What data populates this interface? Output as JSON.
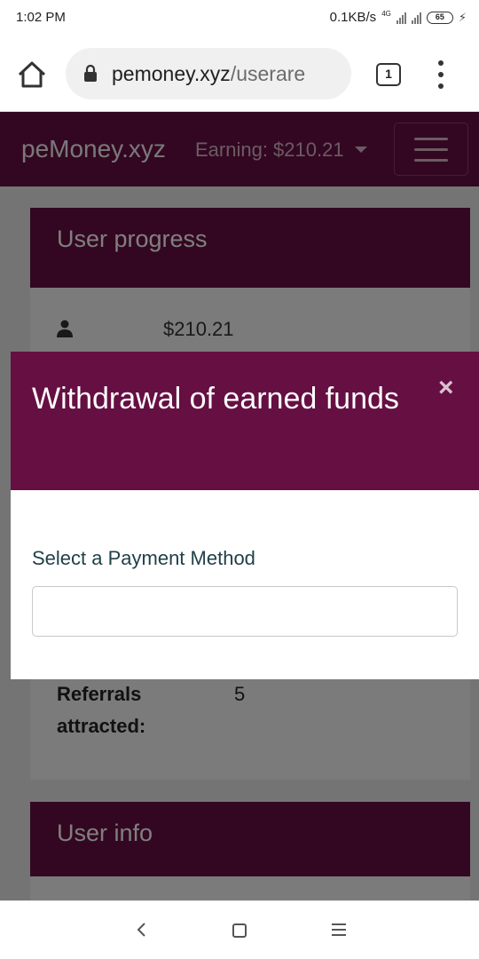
{
  "status_bar": {
    "time": "1:02 PM",
    "speed": "0.1KB/s",
    "network_type": "4G",
    "battery": "65",
    "icons": [
      "signal-icon",
      "signal-icon",
      "battery-icon",
      "charging-icon"
    ]
  },
  "browser": {
    "url_host": "pemoney.xyz",
    "url_path": "/userare",
    "tab_count": "1",
    "icons": [
      "home-icon",
      "lock-icon",
      "tabs-icon",
      "menu-icon"
    ]
  },
  "site": {
    "brand": "peMoney.xyz",
    "earning": "Earning: $210.21",
    "icons": [
      "caret-down-icon",
      "hamburger-icon"
    ]
  },
  "user_progress": {
    "title": "User progress",
    "balance": "$210.21",
    "referrals_label": "Referrals attracted:",
    "referrals_value": "5",
    "icons": [
      "user-icon"
    ]
  },
  "user_info": {
    "title": "User info"
  },
  "modal": {
    "title": "Withdrawal of earned funds",
    "close_label": "×",
    "payment_label": "Select a Payment Method",
    "payment_value": ""
  },
  "colors": {
    "brand": "#660f42",
    "page_background": "#e9e9e9",
    "text_dark": "#22404a"
  },
  "system_nav": {
    "icons": [
      "back-icon",
      "home-square-icon",
      "recents-icon"
    ]
  }
}
